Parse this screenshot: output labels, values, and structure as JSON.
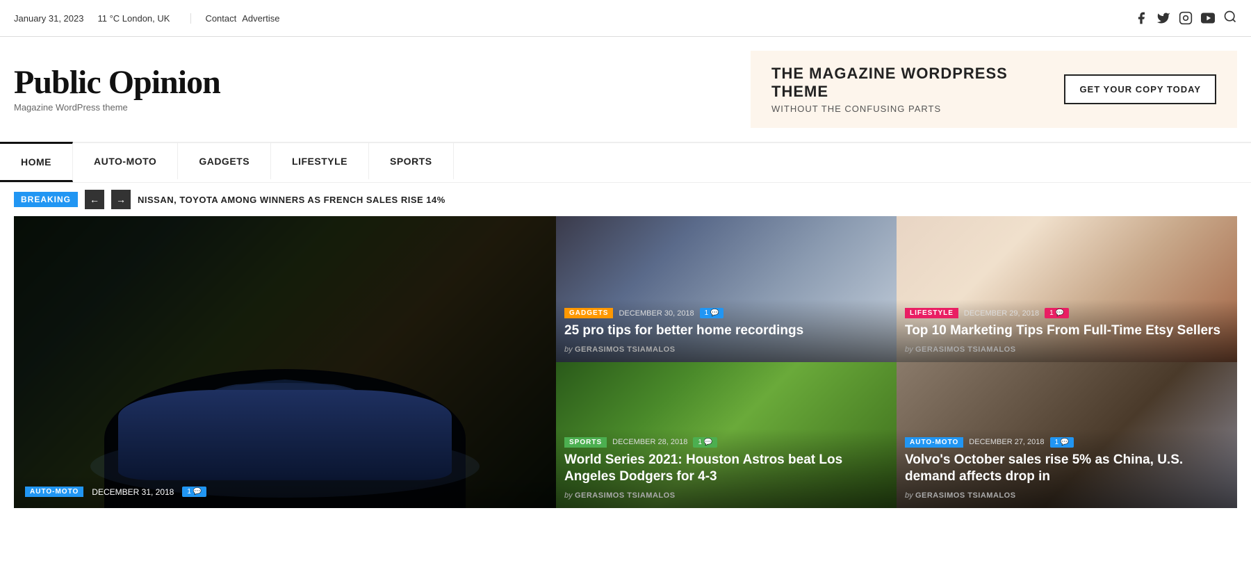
{
  "topbar": {
    "date": "January 31, 2023",
    "weather": "11 °C London, UK",
    "contact": "Contact",
    "advertise": "Advertise"
  },
  "header": {
    "logo_title": "Public Opinion",
    "logo_subtitle": "Magazine WordPress theme",
    "ad_title": "THE MAGAZINE WORDPRESS THEME",
    "ad_subtitle": "WITHOUT THE CONFUSING PARTS",
    "ad_cta": "GET YOUR COPY TODAY"
  },
  "nav": {
    "items": [
      {
        "label": "HOME",
        "active": true
      },
      {
        "label": "AUTO-MOTO",
        "active": false
      },
      {
        "label": "GADGETS",
        "active": false
      },
      {
        "label": "LIFESTYLE",
        "active": false
      },
      {
        "label": "SPORTS",
        "active": false
      }
    ]
  },
  "breaking": {
    "label": "BREAKING",
    "text": "NISSAN, TOYOTA AMONG WINNERS AS FRENCH SALES RISE 14%"
  },
  "featured": {
    "tag": "AUTO-MOTO",
    "date": "DECEMBER 31, 2018",
    "comments": "1"
  },
  "articles": [
    {
      "tag": "GADGETS",
      "tag_class": "tag-gadgets",
      "bubble_class": "bubble-blue",
      "date": "DECEMBER 30, 2018",
      "comments": "1",
      "title": "25 pro tips for better home recordings",
      "author_prefix": "by",
      "author": "GERASIMOS TSIAMALOS",
      "img_class": "img-desk"
    },
    {
      "tag": "LIFESTYLE",
      "tag_class": "tag-lifestyle",
      "bubble_class": "bubble-pink",
      "date": "DECEMBER 29, 2018",
      "comments": "1",
      "title": "Top 10 Marketing Tips From Full-Time Etsy Sellers",
      "author_prefix": "by",
      "author": "GERASIMOS TSIAMALOS",
      "img_class": "img-art"
    },
    {
      "tag": "SPORTS",
      "tag_class": "tag-sports",
      "bubble_class": "bubble-green",
      "date": "DECEMBER 28, 2018",
      "comments": "1",
      "title": "World Series 2021: Houston Astros beat Los Angeles Dodgers for 4-3",
      "author_prefix": "by",
      "author": "GERASIMOS TSIAMALOS",
      "img_class": "img-football"
    },
    {
      "tag": "AUTO-MOTO",
      "tag_class": "tag-auto",
      "bubble_class": "bubble-lblue",
      "date": "DECEMBER 27, 2018",
      "comments": "1",
      "title": "Volvo's October sales rise 5% as China, U.S. demand affects drop in",
      "author_prefix": "by",
      "author": "GERASIMOS TSIAMALOS",
      "img_class": "img-house"
    }
  ]
}
